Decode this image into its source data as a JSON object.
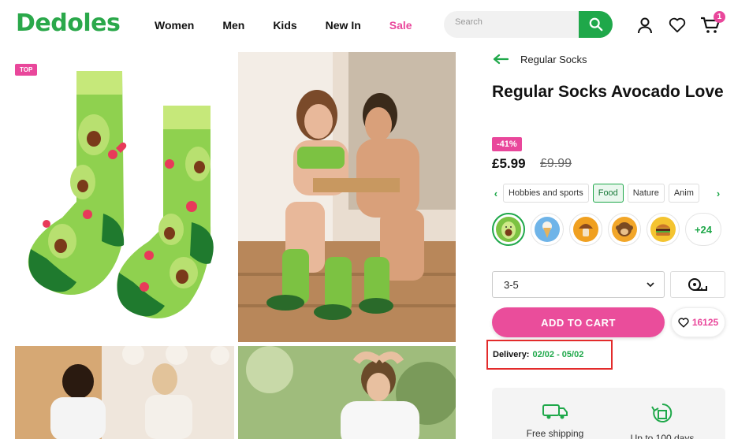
{
  "header": {
    "logo": "Dedoles",
    "nav": [
      "Women",
      "Men",
      "Kids",
      "New In",
      "Sale"
    ],
    "search_placeholder": "Search",
    "cart_count": "1"
  },
  "gallery": {
    "top_tag": "TOP"
  },
  "product": {
    "breadcrumb": "Regular Socks",
    "title": "Regular Socks Avocado Love",
    "discount": "-41%",
    "price": "£5.99",
    "old_price": "£9.99",
    "categories": [
      "Hobbies and sports",
      "Food",
      "Nature",
      "Anim"
    ],
    "active_category": "Food",
    "swatches": [
      {
        "icon": "avocado-icon",
        "color": "#7cc242"
      },
      {
        "icon": "ice-cream-icon",
        "color": "#6fb4e8"
      },
      {
        "icon": "mushroom-icon",
        "color": "#f0a020"
      },
      {
        "icon": "monkey-icon",
        "color": "#f2a628"
      },
      {
        "icon": "burger-icon",
        "color": "#f4c430"
      }
    ],
    "more_swatches": "+24",
    "size": "3-5",
    "add_to_cart": "ADD TO CART",
    "wishlist_count": "16125",
    "delivery_label": "Delivery:",
    "delivery_value": "02/02 - 05/02",
    "info": [
      "Free shipping",
      "Up to 100 days"
    ]
  },
  "colors": {
    "brand_green": "#1fa84a",
    "pink": "#e9479b",
    "highlight_red": "#e32b2b"
  }
}
